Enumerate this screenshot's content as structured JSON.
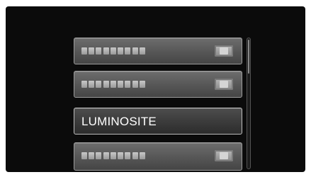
{
  "menu": {
    "items": [
      {
        "label": "",
        "icon": "placeholder-text-icon",
        "value_icon": "setting-value-icon",
        "selected": false
      },
      {
        "label": "",
        "icon": "placeholder-text-icon",
        "value_icon": "setting-value-icon",
        "selected": false
      },
      {
        "label": "LUMINOSITE",
        "selected": true
      },
      {
        "label": "",
        "icon": "placeholder-text-icon",
        "value_icon": "setting-value-icon",
        "selected": false
      }
    ]
  },
  "scrollbar": {
    "position_fraction": 0.0
  },
  "colors": {
    "screen_background": "#0b0b0b",
    "item_gradient_top": "#6d6d6d",
    "item_gradient_bottom": "#454545",
    "selected_text": "#ffffff",
    "page_background": "#ffffff"
  }
}
